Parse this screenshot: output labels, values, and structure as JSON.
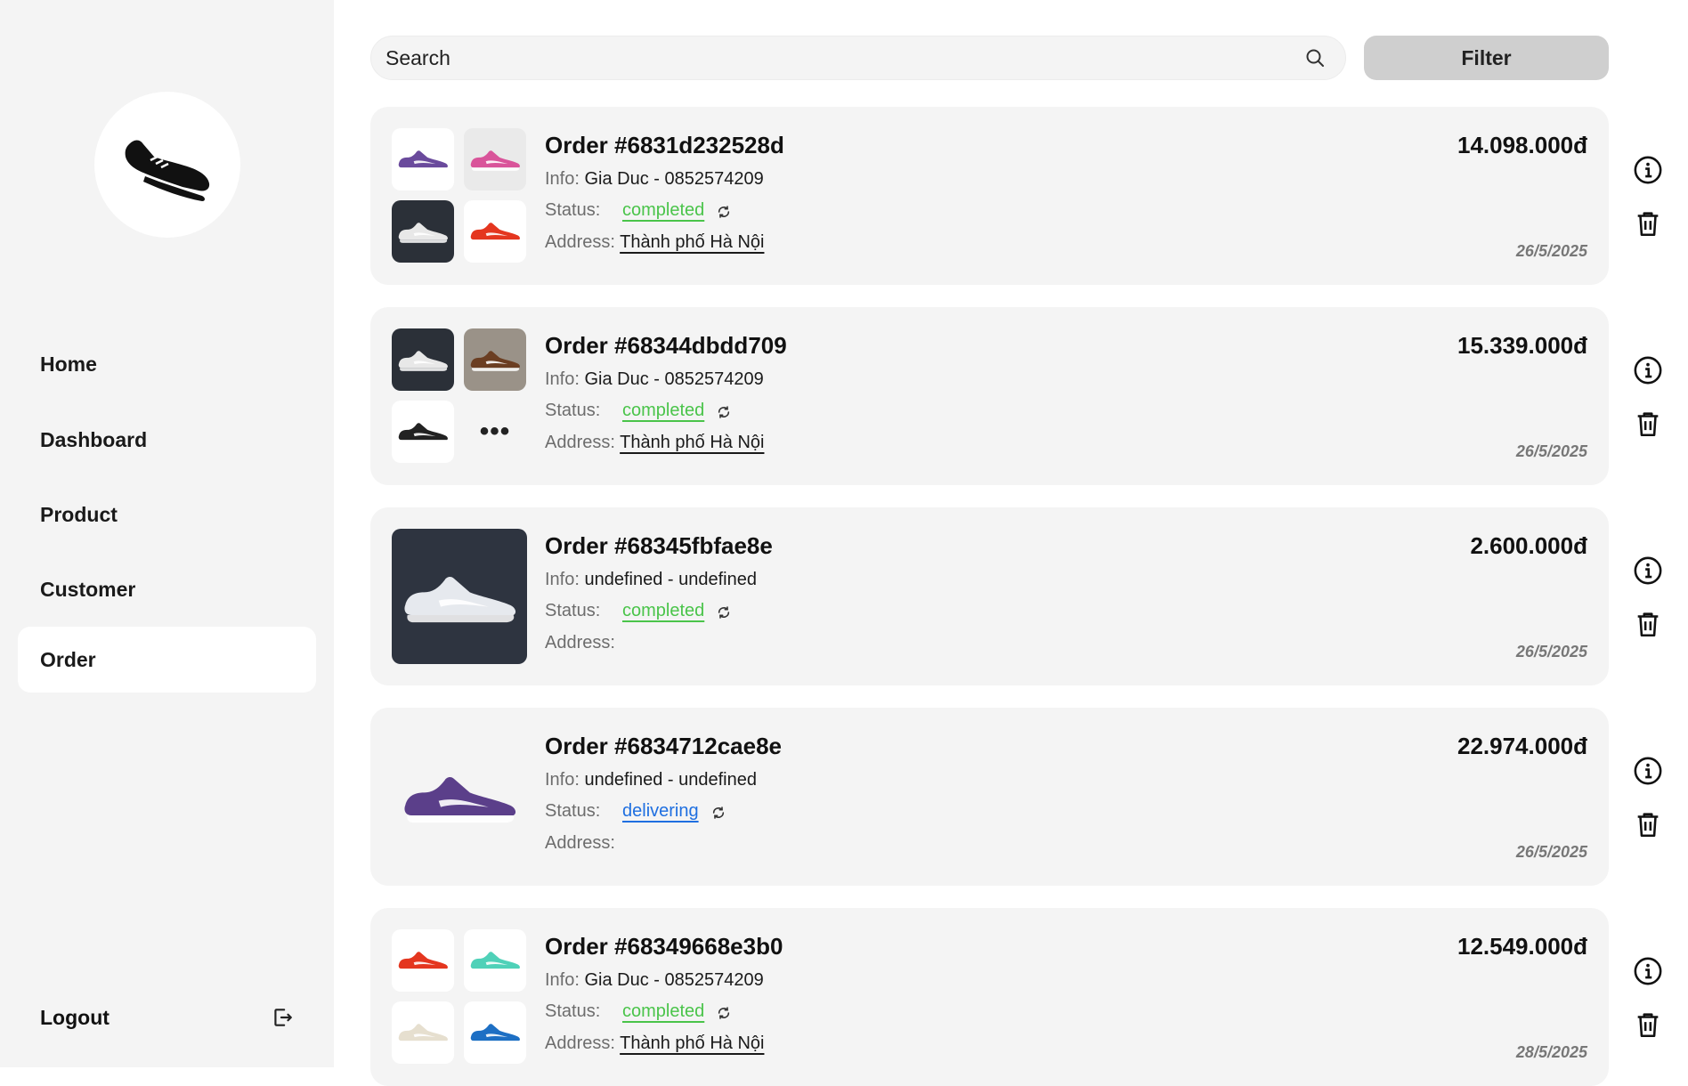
{
  "sidebar": {
    "logo_icon": "sneaker-logo-icon",
    "nav": [
      {
        "label": "Home",
        "active": false
      },
      {
        "label": "Dashboard",
        "active": false
      },
      {
        "label": "Product",
        "active": false
      },
      {
        "label": "Customer",
        "active": false
      },
      {
        "label": "Order",
        "active": true
      }
    ],
    "logout_label": "Logout",
    "logout_icon": "logout-icon"
  },
  "search": {
    "placeholder": "Search",
    "icon": "search-icon"
  },
  "filter_label": "Filter",
  "labels": {
    "info": "Info:",
    "status": "Status:",
    "address": "Address:"
  },
  "orders": [
    {
      "title": "Order #6831d232528d",
      "info_value": "Gia Duc - 0852574209",
      "status": "completed",
      "address": "Thành phố Hà Nội",
      "price": "14.098.000đ",
      "date": "26/5/2025",
      "thumbs": [
        "purple-sneaker",
        "pink-sneaker",
        "white-sneaker-dark-bg",
        "red-sneaker"
      ]
    },
    {
      "title": "Order #68344dbdd709",
      "info_value": "Gia Duc - 0852574209",
      "status": "completed",
      "address": "Thành phố Hà Nội",
      "price": "15.339.000đ",
      "date": "26/5/2025",
      "thumbs": [
        "white-sneaker-dark-bg",
        "brown-sneaker",
        "black-sneaker",
        "more"
      ],
      "more_label": "•••"
    },
    {
      "title": "Order #68345fbfae8e",
      "info_value": "undefined - undefined",
      "status": "completed",
      "address": "",
      "price": "2.600.000đ",
      "date": "26/5/2025",
      "thumbs": [
        "white-sneaker-dark-bg-large"
      ]
    },
    {
      "title": "Order #6834712cae8e",
      "info_value": "undefined - undefined",
      "status": "delivering",
      "address": "",
      "price": "22.974.000đ",
      "date": "26/5/2025",
      "thumbs": [
        "purple-sneaker-large"
      ]
    },
    {
      "title": "Order #68349668e3b0",
      "info_value": "Gia Duc - 0852574209",
      "status": "completed",
      "address": "Thành phố Hà Nội",
      "price": "12.549.000đ",
      "date": "28/5/2025",
      "thumbs": [
        "red-sneaker",
        "mint-sneaker",
        "cream-sneaker",
        "blue-sneaker"
      ]
    }
  ],
  "row_actions": [
    "info-icon",
    "trash-icon"
  ],
  "colors": {
    "completed": "#4ac44a",
    "delivering": "#1f6fe0",
    "sidebar_bg": "#f4f4f4",
    "card_bg": "#f4f4f4",
    "filter_bg": "#cfcfcf"
  }
}
